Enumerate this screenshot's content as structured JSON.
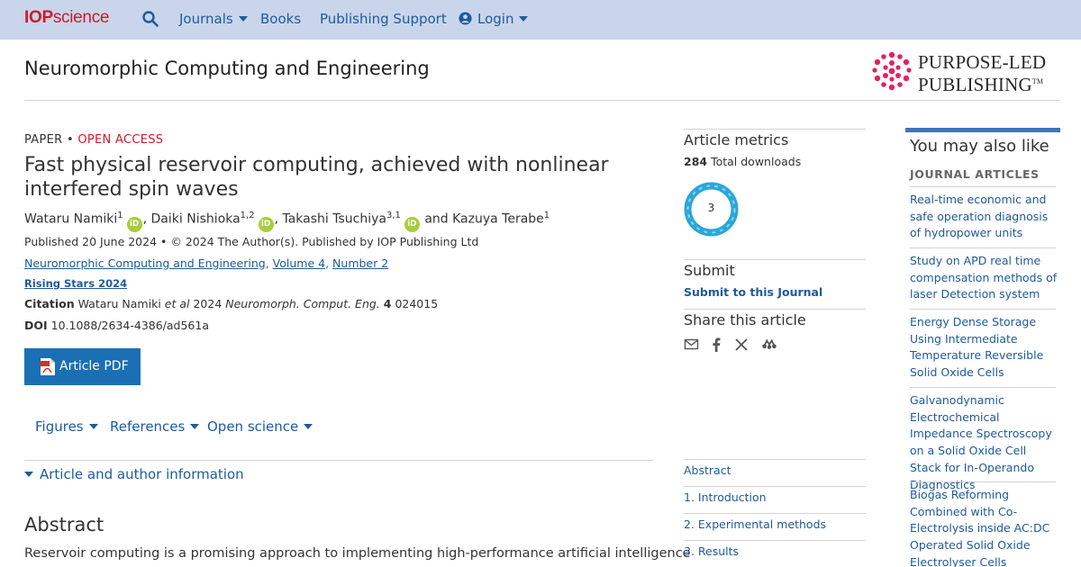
{
  "nav": {
    "logo_bold": "IOP",
    "logo_rest": "science",
    "search_icon": "search-icon",
    "journals": "Journals",
    "books": "Books",
    "publishing_support": "Publishing Support",
    "login": "Login"
  },
  "header": {
    "journal_title": "Neuromorphic Computing and Engineering",
    "brand_line1": "PURPOSE-LED",
    "brand_line2": "PUBLISHING",
    "brand_tm": "TM"
  },
  "article": {
    "type": "PAPER",
    "separator": "•",
    "access": "OPEN ACCESS",
    "title": "Fast physical reservoir computing, achieved with nonlinear interfered spin waves",
    "authors": [
      {
        "name": "Wataru Namiki",
        "aff": "1"
      },
      {
        "name": "Daiki Nishioka",
        "aff": "1,2"
      },
      {
        "name": "Takashi Tsuchiya",
        "aff": "3,1"
      },
      {
        "name": "Kazuya Terabe",
        "aff": "1"
      }
    ],
    "author_join_and": "and",
    "orcid_badge": "iD",
    "published_line": "Published 20 June 2024 • © 2024 The Author(s). Published by IOP Publishing Ltd",
    "breadcrumb_journal": "Neuromorphic Computing and Engineering",
    "breadcrumb_volume": "Volume 4",
    "breadcrumb_number": "Number 2",
    "collection": "Rising Stars 2024",
    "citation_label": "Citation",
    "citation_author": "Wataru Namiki",
    "citation_etal": "et al",
    "citation_year": "2024",
    "citation_journal": "Neuromorph. Comput. Eng.",
    "citation_volume": "4",
    "citation_article": "024015",
    "doi_label": "DOI",
    "doi_value": "10.1088/2634-4386/ad561a",
    "pdf_button": "Article PDF",
    "tabs": [
      "Figures",
      "References",
      "Open science"
    ],
    "info_toggle": "Article and author information",
    "abstract_heading": "Abstract",
    "abstract_text": "Reservoir computing is a promising approach to implementing high-performance artificial intelligence"
  },
  "sidebar": {
    "metrics_heading": "Article metrics",
    "downloads_count": "284",
    "downloads_label": "Total downloads",
    "altmetric_score": "3",
    "submit_heading": "Submit",
    "submit_link": "Submit to this Journal",
    "share_heading": "Share this article",
    "share_icons": [
      "email-icon",
      "facebook-icon",
      "x-icon",
      "mendeley-icon"
    ],
    "toc": [
      "Abstract",
      "1. Introduction",
      "2. Experimental methods",
      "3. Results"
    ]
  },
  "related": {
    "heading": "You may also like",
    "subheading": "JOURNAL ARTICLES",
    "items": [
      "Real-time economic and safe operation diagnosis of hydropower units",
      "Study on APD real time compensation methods of laser Detection system",
      "Energy Dense Storage Using Intermediate Temperature Reversible Solid Oxide Cells",
      "Galvanodynamic Electrochemical Impedance Spectroscopy on a Solid Oxide Cell Stack for In-Operando Diagnostics",
      "Biogas Reforming Combined with Co-Electrolysis inside AC:DC Operated Solid Oxide Electrolyser Cells"
    ]
  },
  "colors": {
    "nav_bg": "#c9d5ea",
    "link": "#1f5a9c",
    "brand_red": "#cc1a2b",
    "pdf_button": "#1b6fb4",
    "orcid_green": "#a6ce39",
    "altmetric_blue": "#2aa7d8"
  }
}
